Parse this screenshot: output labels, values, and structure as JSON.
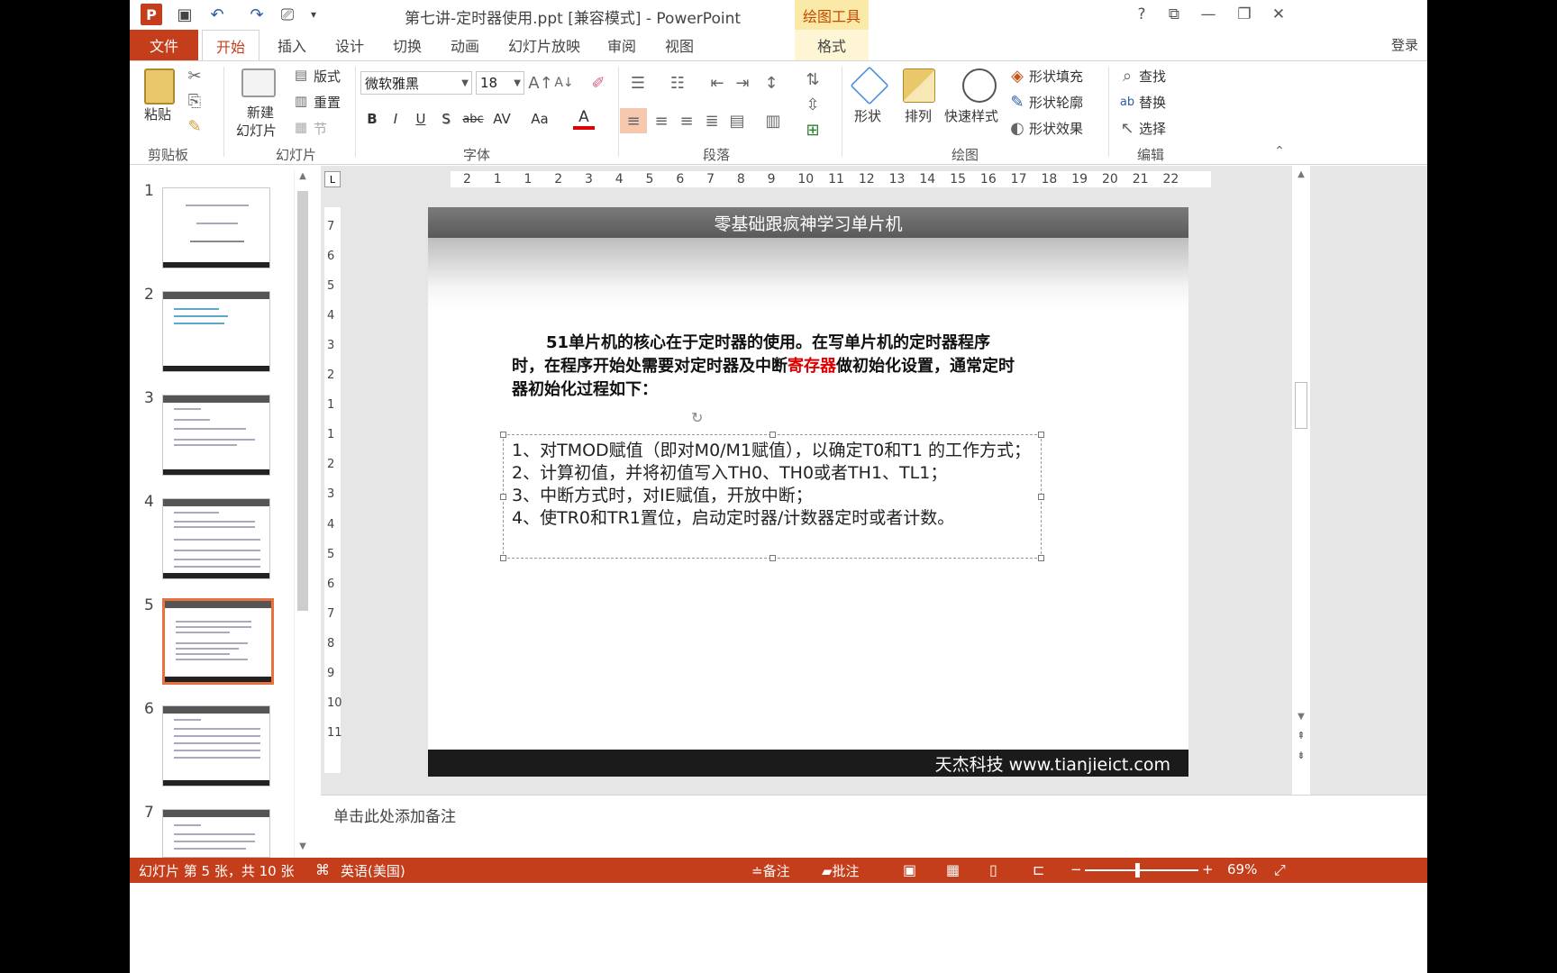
{
  "window": {
    "title": "第七讲-定时器使用.ppt [兼容模式] - PowerPoint",
    "context_tab_group": "绘图工具",
    "help": "?",
    "login": "登录"
  },
  "tabs": [
    {
      "label": "文件"
    },
    {
      "label": "开始"
    },
    {
      "label": "插入"
    },
    {
      "label": "设计"
    },
    {
      "label": "切换"
    },
    {
      "label": "动画"
    },
    {
      "label": "幻灯片放映"
    },
    {
      "label": "审阅"
    },
    {
      "label": "视图"
    },
    {
      "label": "格式"
    }
  ],
  "ribbon": {
    "clipboard": {
      "paste": "粘贴",
      "label": "剪贴板"
    },
    "slides": {
      "new_slide_1": "新建",
      "new_slide_2": "幻灯片",
      "layout": "版式",
      "reset": "重置",
      "section": "节",
      "label": "幻灯片"
    },
    "font": {
      "name": "微软雅黑",
      "size": "18",
      "label": "字体",
      "bold": "B",
      "italic": "I",
      "underline": "U",
      "shadow": "S",
      "strike": "abc",
      "spacing": "AV",
      "case": "Aa",
      "color": "A"
    },
    "paragraph": {
      "label": "段落"
    },
    "drawing": {
      "shape": "形状",
      "arrange": "排列",
      "quick_styles": "快速样式",
      "fill": "形状填充",
      "outline": "形状轮廓",
      "effects": "形状效果",
      "label": "绘图"
    },
    "editing": {
      "find": "查找",
      "replace": "替换",
      "select": "选择",
      "label": "编辑"
    }
  },
  "thumbnails": [
    {
      "num": "1"
    },
    {
      "num": "2"
    },
    {
      "num": "3"
    },
    {
      "num": "4"
    },
    {
      "num": "5"
    },
    {
      "num": "6"
    },
    {
      "num": "7"
    }
  ],
  "ruler": {
    "h": [
      "2",
      "1",
      "1",
      "2",
      "3",
      "4",
      "5",
      "6",
      "7",
      "8",
      "9",
      "10",
      "11",
      "12",
      "13",
      "14",
      "15",
      "16",
      "17",
      "18",
      "19",
      "20",
      "21",
      "22"
    ],
    "v": [
      "7",
      "6",
      "5",
      "4",
      "3",
      "2",
      "1",
      "1",
      "2",
      "3",
      "4",
      "5",
      "6",
      "7",
      "8",
      "9",
      "10",
      "11"
    ]
  },
  "slide": {
    "header": "零基础跟疯神学习单片机",
    "intro_a": "51单片机的核心在于定时器的使用。在写单片机的定时器程序时，在程序开始处需要对定时器及中断",
    "intro_red": "寄存器",
    "intro_b": "做初始化设置，通常定时器初始化过程如下：",
    "steps": [
      "1、对TMOD赋值（即对M0/M1赋值），以确定T0和T1 的工作方式；",
      "2、计算初值，并将初值写入TH0、TH0或者TH1、TL1；",
      "3、中断方式时，对IE赋值，开放中断；",
      "4、使TR0和TR1置位，启动定时器/计数器定时或者计数。"
    ],
    "footer": "天杰科技  www.tianjieict.com"
  },
  "notes": {
    "placeholder": "单击此处添加备注"
  },
  "status": {
    "slide_info": "幻灯片 第 5 张，共 10 张",
    "language": "英语(美国)",
    "notes": "备注",
    "comments": "批注",
    "zoom": "69%",
    "zoom_level": 0.46
  }
}
